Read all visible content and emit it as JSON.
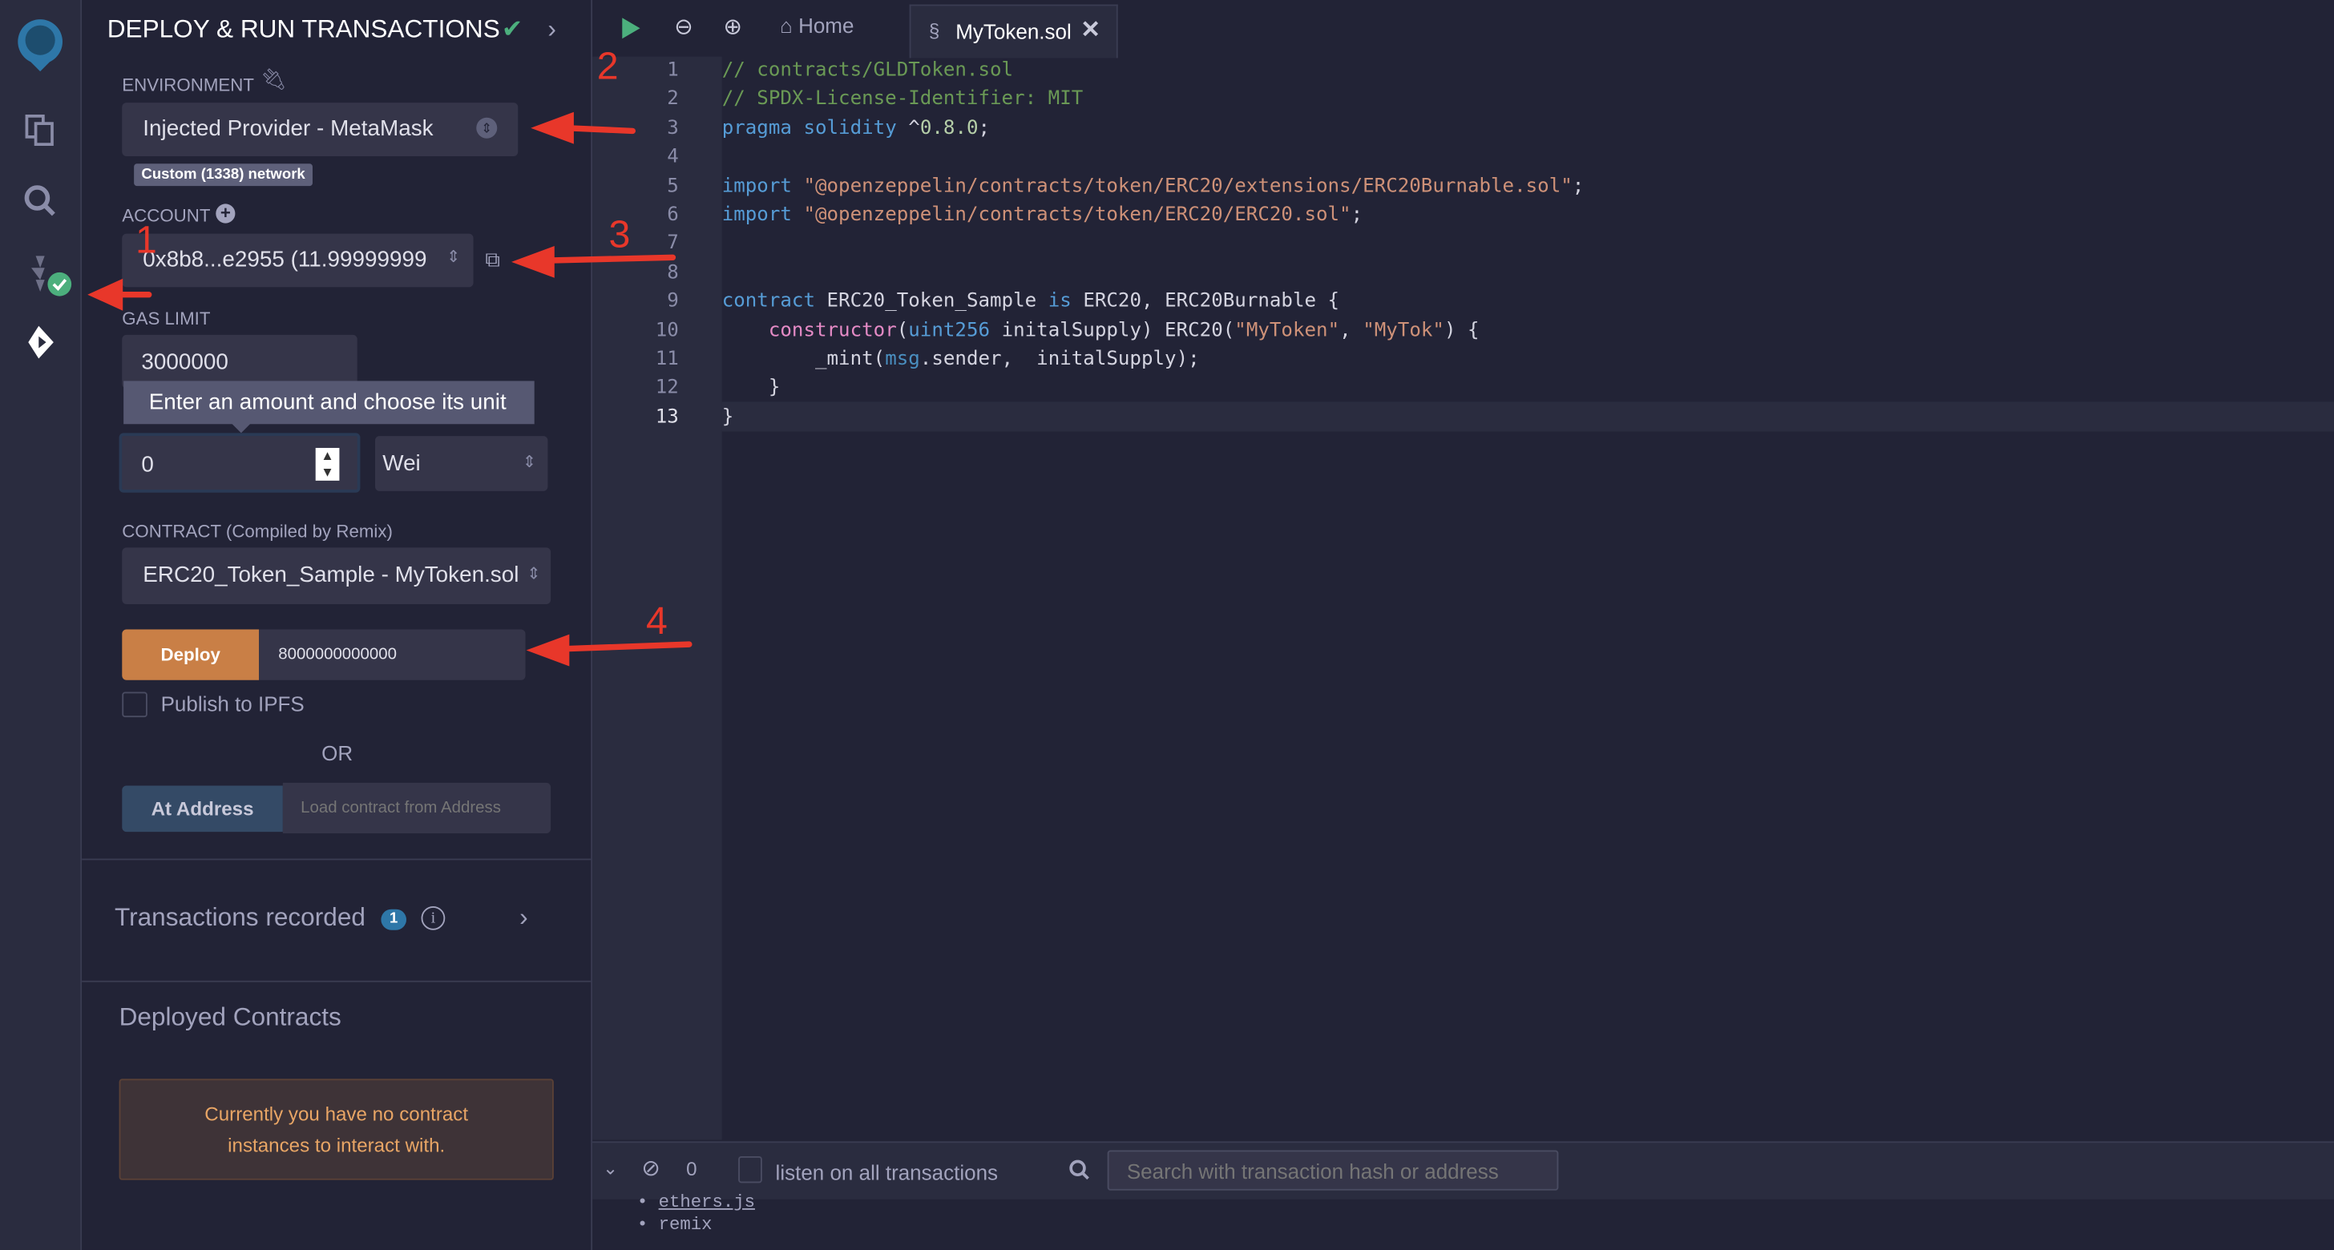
{
  "colors": {
    "accent_deploy": "#c97f46",
    "at_address": "#344a66",
    "success": "#4caf7d",
    "annotation": "#e8372a",
    "badge": "#2e77a8",
    "warning_text": "#e8a565"
  },
  "iconbar": {
    "items": [
      {
        "icon": "remix-logo-icon"
      },
      {
        "icon": "file-explorer-icon"
      },
      {
        "icon": "search-icon"
      },
      {
        "icon": "solidity-compiler-icon"
      },
      {
        "icon": "deploy-run-icon"
      }
    ]
  },
  "panel": {
    "title": "DEPLOY & RUN TRANSACTIONS",
    "environment_label": "ENVIRONMENT",
    "environment_value": "Injected Provider - MetaMask",
    "network_badge": "Custom (1338) network",
    "account_label": "ACCOUNT",
    "account_value": "0x8b8...e2955 (11.99999999",
    "gas_limit_label": "GAS LIMIT",
    "gas_limit_value": "3000000",
    "value_tooltip": "Enter an amount and choose its unit",
    "value_amount": "0",
    "value_unit": "Wei",
    "contract_label": "CONTRACT",
    "contract_sublabel": "(Compiled by Remix)",
    "contract_value": "ERC20_Token_Sample - MyToken.sol",
    "deploy_label": "Deploy",
    "deploy_arg": "8000000000000",
    "publish_ipfs": "Publish to IPFS",
    "or": "OR",
    "at_address_label": "At Address",
    "at_address_placeholder": "Load contract from Address",
    "transactions_recorded": "Transactions recorded",
    "transactions_count": "1",
    "deployed_contracts": "Deployed Contracts",
    "no_instances": "Currently you have no contract instances to interact with."
  },
  "tabs": {
    "home": "Home",
    "file": "MyToken.sol"
  },
  "code": {
    "active_line": "13",
    "lines": [
      [
        {
          "t": "// contracts/GLDToken.sol",
          "c": "#6a9955"
        }
      ],
      [
        {
          "t": "// SPDX-License-Identifier: MIT",
          "c": "#6a9955"
        }
      ],
      [
        {
          "t": "pragma",
          "c": "#569cd6"
        },
        {
          "t": " "
        },
        {
          "t": "solidity",
          "c": "#569cd6"
        },
        {
          "t": " ^"
        },
        {
          "t": "0.8.0",
          "c": "#b5cea8"
        },
        {
          "t": ";"
        }
      ],
      [],
      [
        {
          "t": "import",
          "c": "#569cd6"
        },
        {
          "t": " "
        },
        {
          "t": "\"@openzeppelin/contracts/token/ERC20/extensions/ERC20Burnable.sol\"",
          "c": "#ce9178"
        },
        {
          "t": ";"
        }
      ],
      [
        {
          "t": "import",
          "c": "#569cd6"
        },
        {
          "t": " "
        },
        {
          "t": "\"@openzeppelin/contracts/token/ERC20/ERC20.sol\"",
          "c": "#ce9178"
        },
        {
          "t": ";"
        }
      ],
      [],
      [],
      [
        {
          "t": "contract",
          "c": "#569cd6"
        },
        {
          "t": " ERC20_Token_Sample "
        },
        {
          "t": "is",
          "c": "#569cd6"
        },
        {
          "t": " ERC20, ERC20Burnable {"
        }
      ],
      [
        {
          "t": "    "
        },
        {
          "t": "constructor",
          "c": "#e58bc6"
        },
        {
          "t": "("
        },
        {
          "t": "uint256",
          "c": "#569cd6"
        },
        {
          "t": " initalSupply) ERC20("
        },
        {
          "t": "\"MyToken\"",
          "c": "#ce9178"
        },
        {
          "t": ", "
        },
        {
          "t": "\"MyTok\"",
          "c": "#ce9178"
        },
        {
          "t": ") {"
        }
      ],
      [
        {
          "t": "        _mint("
        },
        {
          "t": "msg",
          "c": "#4a8fc0"
        },
        {
          "t": ".sender,  initalSupply);"
        }
      ],
      [
        {
          "t": "    }"
        }
      ],
      [
        {
          "t": "}"
        }
      ]
    ]
  },
  "terminal": {
    "count": "0",
    "listen_label": "listen on all transactions",
    "search_placeholder": "Search with transaction hash or address",
    "list": [
      "ethers.js",
      "remix"
    ]
  },
  "annotations": [
    "1",
    "2",
    "3",
    "4"
  ]
}
